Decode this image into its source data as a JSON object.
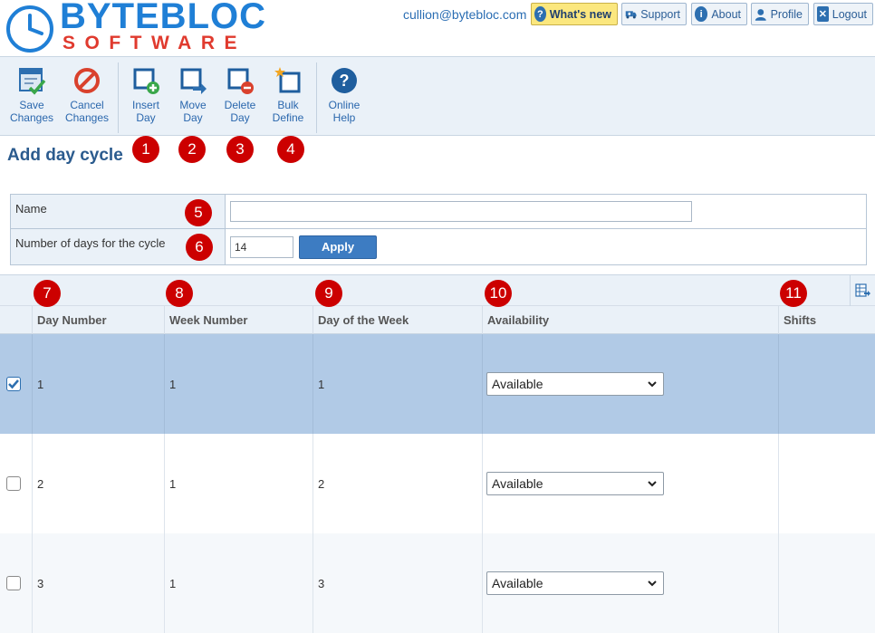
{
  "header": {
    "logo_name": "BYTEBLOC",
    "logo_sub": "SOFTWARE",
    "user_email": "cullion@bytebloc.com",
    "buttons": {
      "whats_new": "What's new",
      "support": "Support",
      "about": "About",
      "profile": "Profile",
      "logout": "Logout"
    }
  },
  "toolbar": {
    "save": [
      "Save",
      "Changes"
    ],
    "cancel": [
      "Cancel",
      "Changes"
    ],
    "insert": [
      "Insert",
      "Day"
    ],
    "move": [
      "Move",
      "Day"
    ],
    "delete": [
      "Delete",
      "Day"
    ],
    "bulk": [
      "Bulk",
      "Define"
    ],
    "help": [
      "Online",
      "Help"
    ]
  },
  "badges": [
    "1",
    "2",
    "3",
    "4",
    "5",
    "6",
    "7",
    "8",
    "9",
    "10",
    "11"
  ],
  "page_title": "Add day cycle",
  "form": {
    "name_label": "Name",
    "name_value": "",
    "days_label": "Number of days for the cycle",
    "days_value": "14",
    "apply_label": "Apply"
  },
  "grid": {
    "columns": {
      "day_number": "Day Number",
      "week_number": "Week Number",
      "day_of_week": "Day of the Week",
      "availability": "Availability",
      "shifts": "Shifts"
    },
    "rows": [
      {
        "day_number": "1",
        "week_number": "1",
        "day_of_week": "1",
        "availability": "Available",
        "shifts": "",
        "checked": true
      },
      {
        "day_number": "2",
        "week_number": "1",
        "day_of_week": "2",
        "availability": "Available",
        "shifts": "",
        "checked": false
      },
      {
        "day_number": "3",
        "week_number": "1",
        "day_of_week": "3",
        "availability": "Available",
        "shifts": "",
        "checked": false
      }
    ]
  },
  "colors": {
    "accent": "#2a67ad",
    "badge": "#cc0000",
    "selected_row": "#b1cae6",
    "toolbar_bg": "#eaf1f8"
  }
}
